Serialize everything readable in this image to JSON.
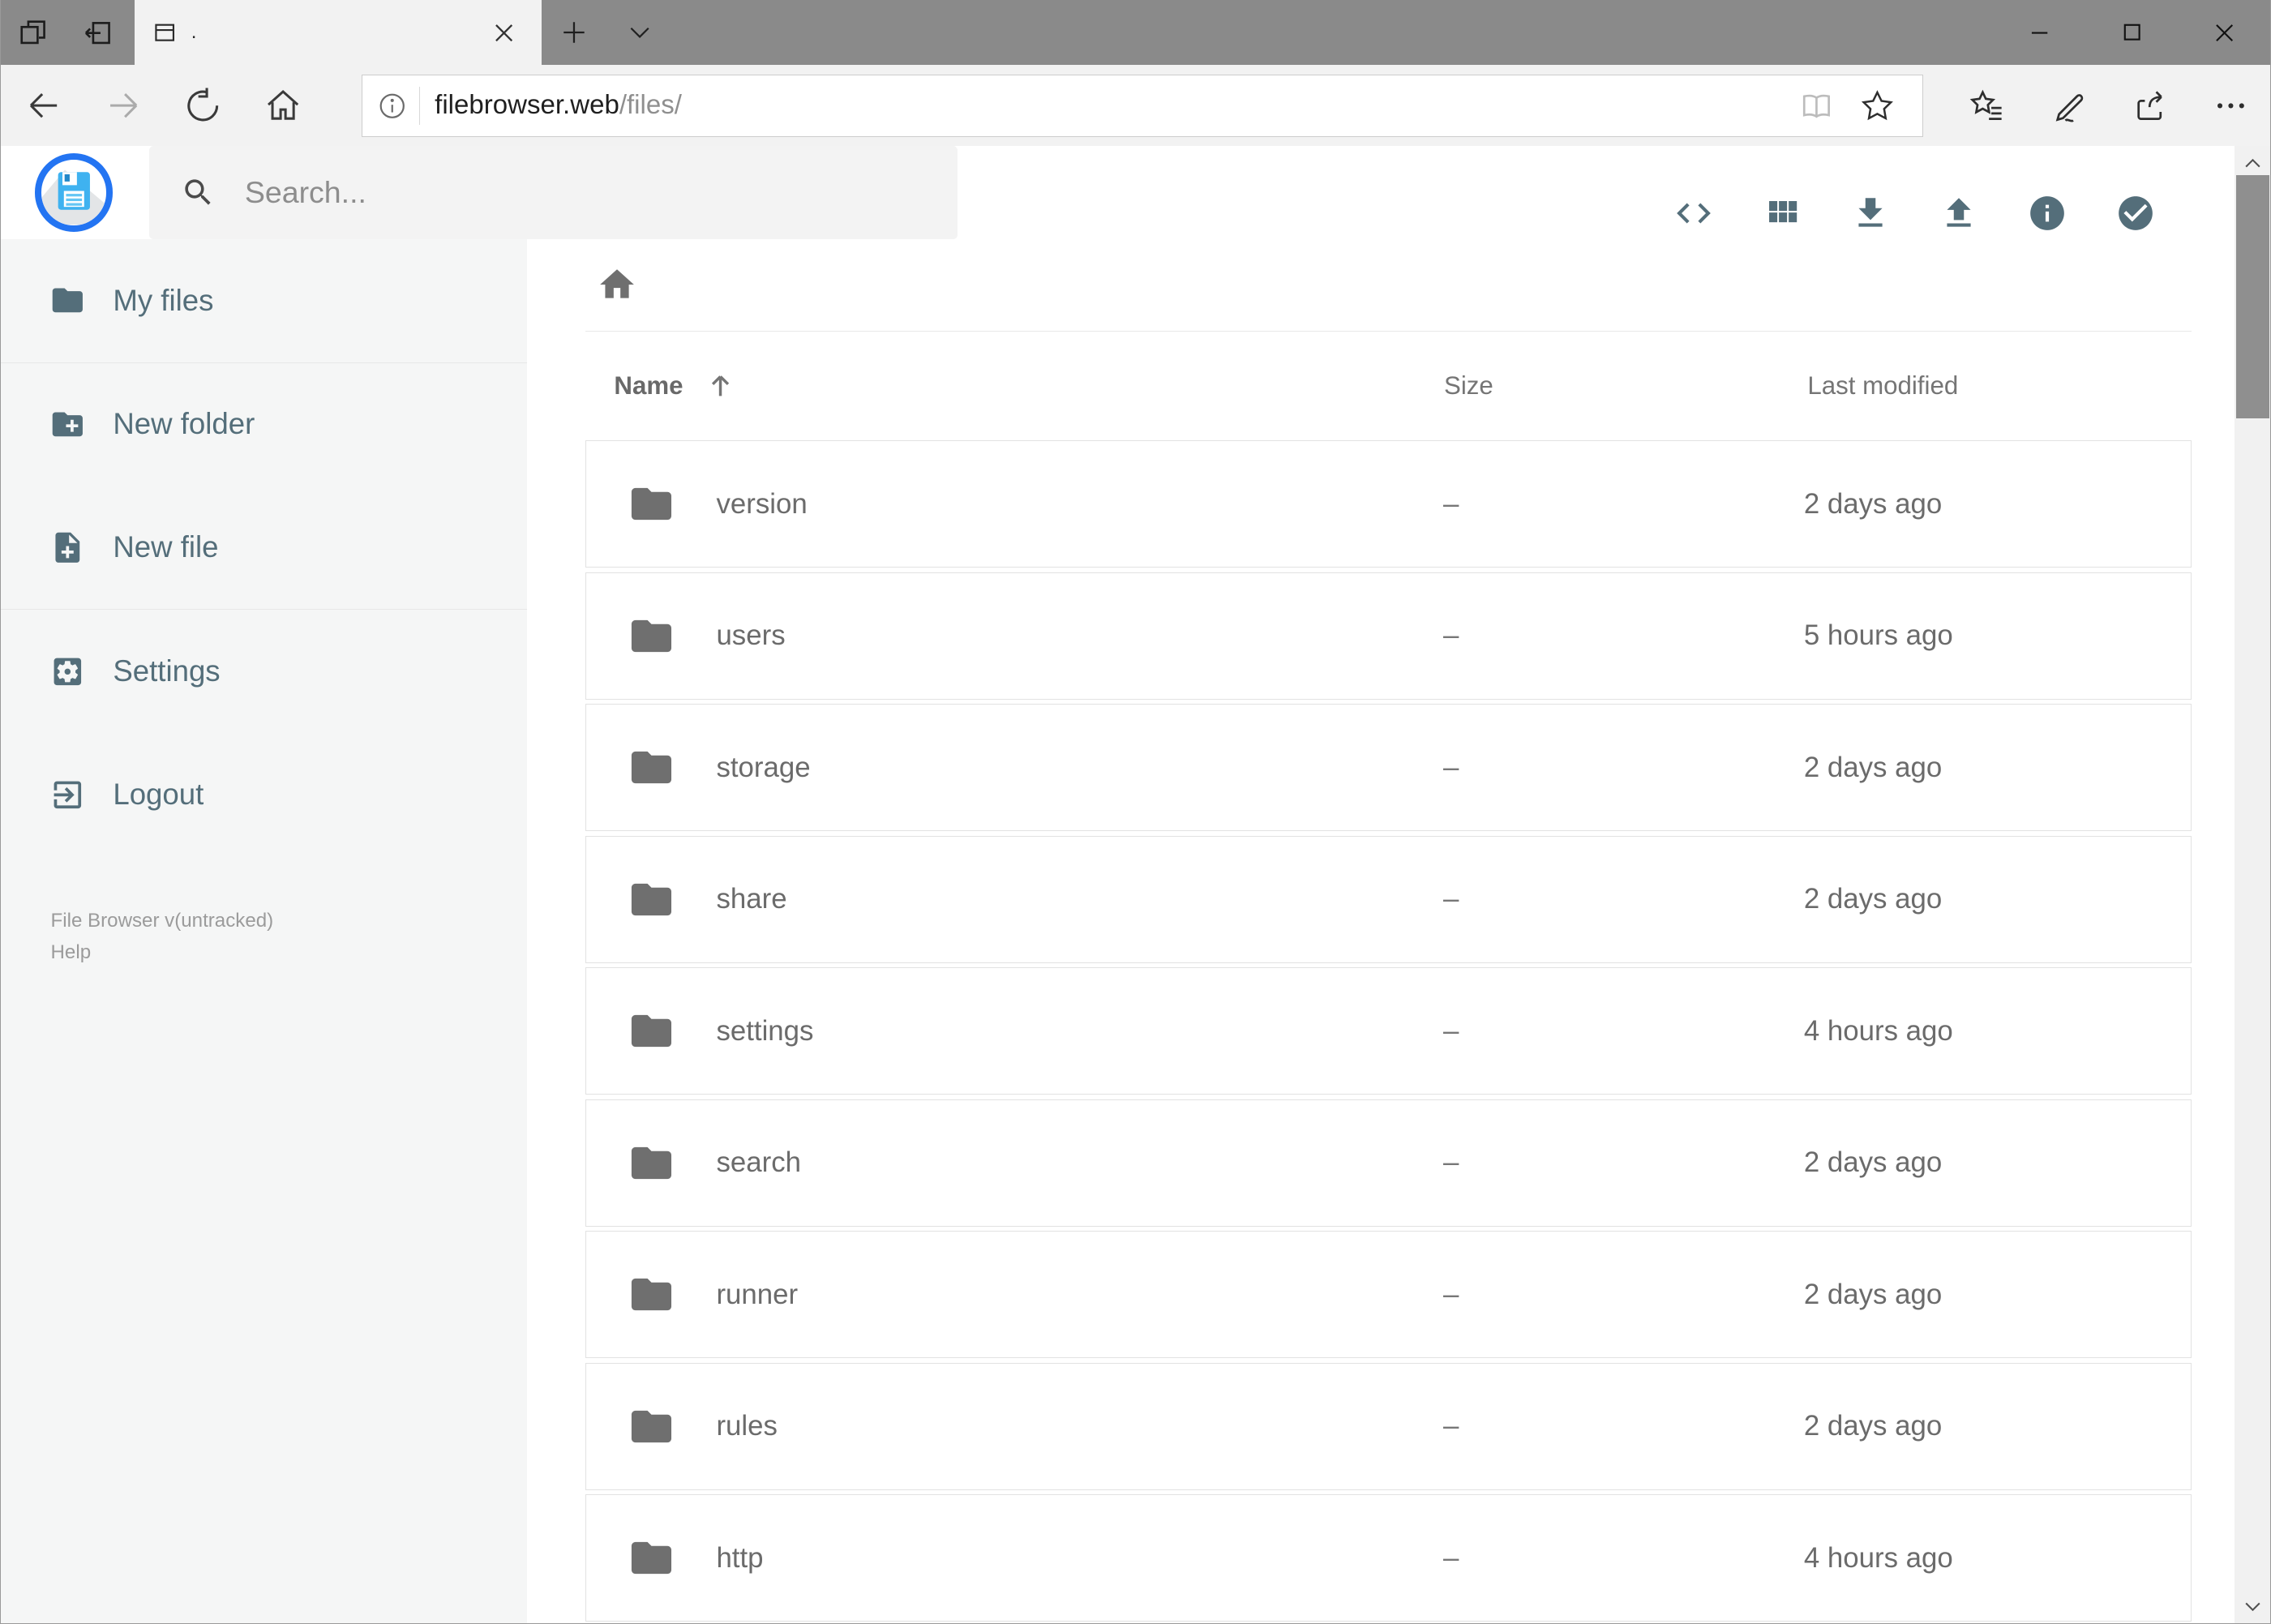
{
  "window": {
    "tab_title": ".",
    "url_host": "filebrowser.web",
    "url_path": "/files/"
  },
  "app": {
    "search_placeholder": "Search...",
    "sidebar": {
      "items": [
        {
          "label": "My files"
        },
        {
          "label": "New folder"
        },
        {
          "label": "New file"
        },
        {
          "label": "Settings"
        },
        {
          "label": "Logout"
        }
      ],
      "version": "File Browser v(untracked)",
      "help": "Help"
    },
    "listing": {
      "headers": {
        "name": "Name",
        "size": "Size",
        "modified": "Last modified"
      },
      "rows": [
        {
          "name": "version",
          "size": "–",
          "modified": "2 days ago"
        },
        {
          "name": "users",
          "size": "–",
          "modified": "5 hours ago"
        },
        {
          "name": "storage",
          "size": "–",
          "modified": "2 days ago"
        },
        {
          "name": "share",
          "size": "–",
          "modified": "2 days ago"
        },
        {
          "name": "settings",
          "size": "–",
          "modified": "4 hours ago"
        },
        {
          "name": "search",
          "size": "–",
          "modified": "2 days ago"
        },
        {
          "name": "runner",
          "size": "–",
          "modified": "2 days ago"
        },
        {
          "name": "rules",
          "size": "–",
          "modified": "2 days ago"
        },
        {
          "name": "http",
          "size": "–",
          "modified": "4 hours ago"
        }
      ]
    }
  },
  "colors": {
    "accent_slate": "#546e7a",
    "logo_ring_blue": "#2374f2",
    "floppy_blue": "#3fb2f0",
    "titlebar_gray": "#8a8a8a",
    "chrome_gray": "#f2f2f2",
    "row_border": "#e2e2e2",
    "icon_gray": "#6f6f6f"
  }
}
